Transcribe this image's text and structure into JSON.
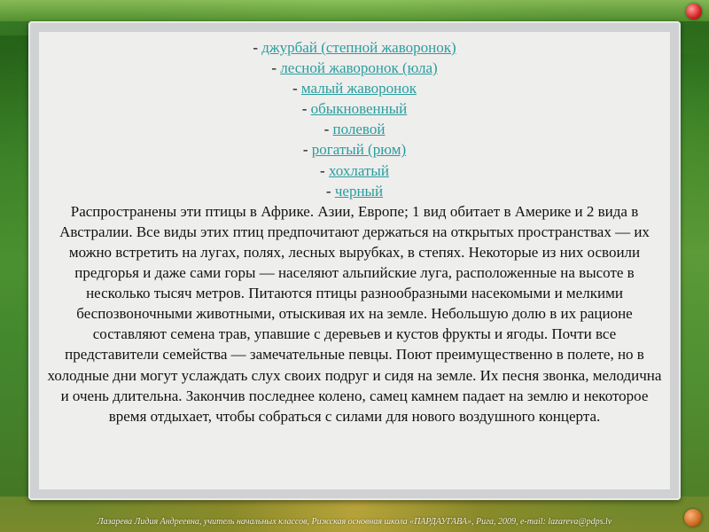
{
  "list": [
    {
      "prefix": "- ",
      "label": "джурбай (степной жаворонок)"
    },
    {
      "prefix": "- ",
      "label": "лесной жаворонок (юла)"
    },
    {
      "prefix": "- ",
      "label": "малый жаворонок"
    },
    {
      "prefix": "- ",
      "label": "обыкновенный"
    },
    {
      "prefix": "- ",
      "label": "полевой"
    },
    {
      "prefix": "- ",
      "label": "рогатый (рюм)"
    },
    {
      "prefix": "- ",
      "label": "хохлатый"
    },
    {
      "prefix": "- ",
      "label": "черный"
    }
  ],
  "paragraph": "Распространены эти птицы в Африке. Азии, Европе; 1 вид обитает в Америке и 2 вида в Австралии. Все виды этих птиц предпочитают держаться на открытых пространствах — их можно встретить на лугах, полях, лесных вырубках, в степях. Некоторые из них освоили предгорья и даже сами горы — населяют альпийские луга, расположенные на высоте в несколько тысяч метров. Питаются птицы разнообразными насекомыми и мелкими беспозвоночными животными, отыскивая их на земле. Небольшую долю в их рационе составляют семена трав, упавшие с деревьев и кустов фрукты и ягоды. Почти все представители семейства — замечательные певцы. Поют преимущественно в полете, но в холодные дни могут услаждать слух своих подруг и сидя на земле. Их песня звонка, мелодична и очень длительна. Закончив последнее колено, самец камнем падает на землю и некоторое время отдыхает, чтобы собраться с силами для нового воздушного концерта.",
  "footer": "Лазарева Лидия Андреевна, учитель начальных классов, Рижская основная школа «ПАРДАУГАВА», Рига, 2009, e-mail: lazareva@pdps.lv",
  "colors": {
    "link": "#2a9d9d",
    "panel": "#eeeeed",
    "frame": "#cfd1d3"
  },
  "icons": {
    "top_right": "red-ball-icon",
    "bottom_right": "orange-ball-icon"
  }
}
